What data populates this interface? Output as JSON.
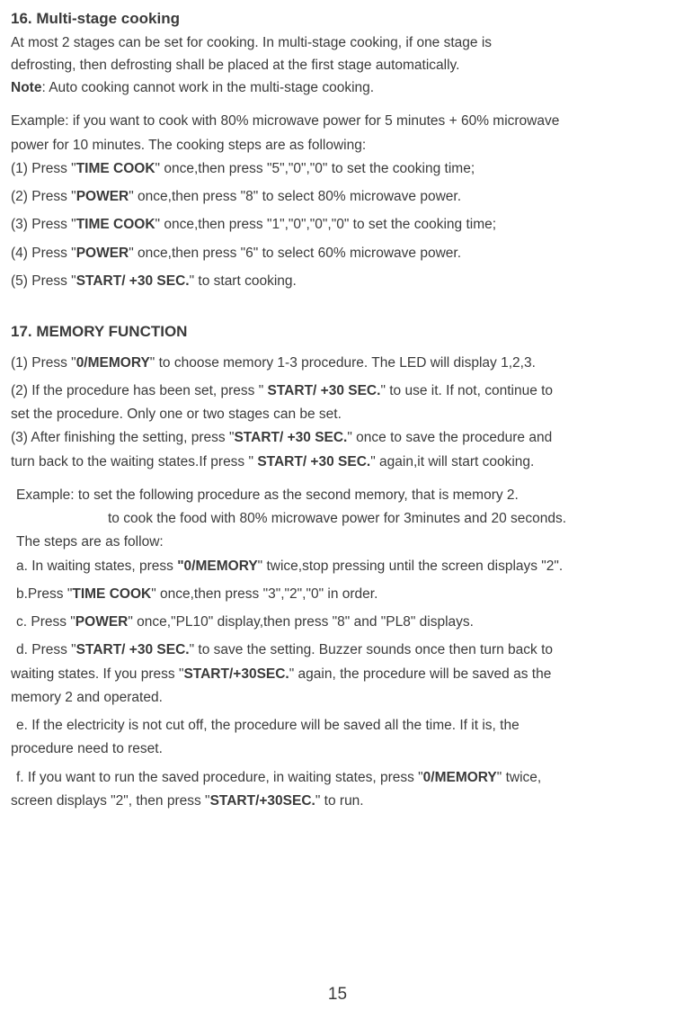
{
  "s16": {
    "title": "16. Multi-stage cooking",
    "p1": "At most 2 stages can be set for cooking. In multi-stage cooking, if one stage is",
    "p2": "defrosting, then defrosting shall be placed at the first stage automatically.",
    "noteLabel": "Note",
    "noteText": ": Auto cooking cannot work in the multi-stage cooking.",
    "example1": "Example: if you want to cook with 80% microwave power for 5 minutes + 60% microwave",
    "example2": "power for 10 minutes. The cooking steps are as following:",
    "step1a": "(1) Press \"",
    "step1b": "TIME COOK",
    "step1c": "\" once,then press \"5\",\"0\",\"0\" to set the cooking time;",
    "step2a": "(2) Press \"",
    "step2b": "POWER",
    "step2c": "\" once,then press \"8\" to select 80% microwave power.",
    "step3a": "(3) Press \"",
    "step3b": "TIME COOK",
    "step3c": "\" once,then press \"1\",\"0\",\"0\",\"0\" to set the cooking time;",
    "step4a": "(4) Press \"",
    "step4b": "POWER",
    "step4c": "\" once,then press \"6\" to select 60% microwave power.",
    "step5a": "(5) Press \"",
    "step5b": "START/ +30 SEC.",
    "step5c": "\" to start cooking."
  },
  "s17": {
    "title": "17. MEMORY FUNCTION",
    "p1a": "(1) Press \"",
    "p1b": "0/MEMORY",
    "p1c": "\" to choose memory 1-3 procedure. The LED will display 1,2,3.",
    "p2a": "(2) If the procedure has been set, press \" ",
    "p2b": "START/ +30 SEC.",
    "p2c": "\" to use it. If not, continue to",
    "p2d": "set  the procedure. Only one or two stages can be set.",
    "p3a": "(3) After finishing the setting, press \"",
    "p3b": "START/ +30 SEC.",
    "p3c": "\" once to save the procedure and",
    "p3d": "turn back to the waiting states.If press \" ",
    "p3e": "START/ +30 SEC.",
    "p3f": "\" again,it will start cooking.",
    "ex1": "Example: to set the following procedure as the second memory, that is memory 2.",
    "ex2": "to cook the food with 80% microwave power for 3minutes and 20 seconds.",
    "ex3": "The steps are as follow:",
    "sa_a": "a. In waiting states, press ",
    "sa_b": "\"0/MEMORY",
    "sa_c": "\" twice,stop pressing until the screen displays \"2\".",
    "sb_a": "b.Press \"",
    "sb_b": "TIME COOK",
    "sb_c": "\" once,then press \"3\",\"2\",\"0\" in order.",
    "sc_a": "c. Press \"",
    "sc_b": "POWER",
    "sc_c": "\" once,\"PL10\" display,then press \"8\" and  \"PL8\" displays.",
    "sd_a": "d. Press \"",
    "sd_b": "START/ +30 SEC.",
    "sd_c": "\" to save the setting. Buzzer sounds once then turn back to",
    "sd_d": "waiting states. If you press \"",
    "sd_e": "START/+30SEC.",
    "sd_f": "\" again, the procedure will be saved as the",
    "sd_g": "memory 2 and operated.",
    "se_a": "e. If the electricity is not cut off, the procedure will be saved all the time. If it is, the",
    "se_b": "procedure need to reset.",
    "sf_a": "f.  If you want to run the saved procedure, in waiting states, press \"",
    "sf_b": "0/MEMORY",
    "sf_c": "\" twice,",
    "sf_d": "screen  displays \"2\", then press \"",
    "sf_e": "START/+30SEC.",
    "sf_f": "\" to run."
  },
  "page": "15"
}
